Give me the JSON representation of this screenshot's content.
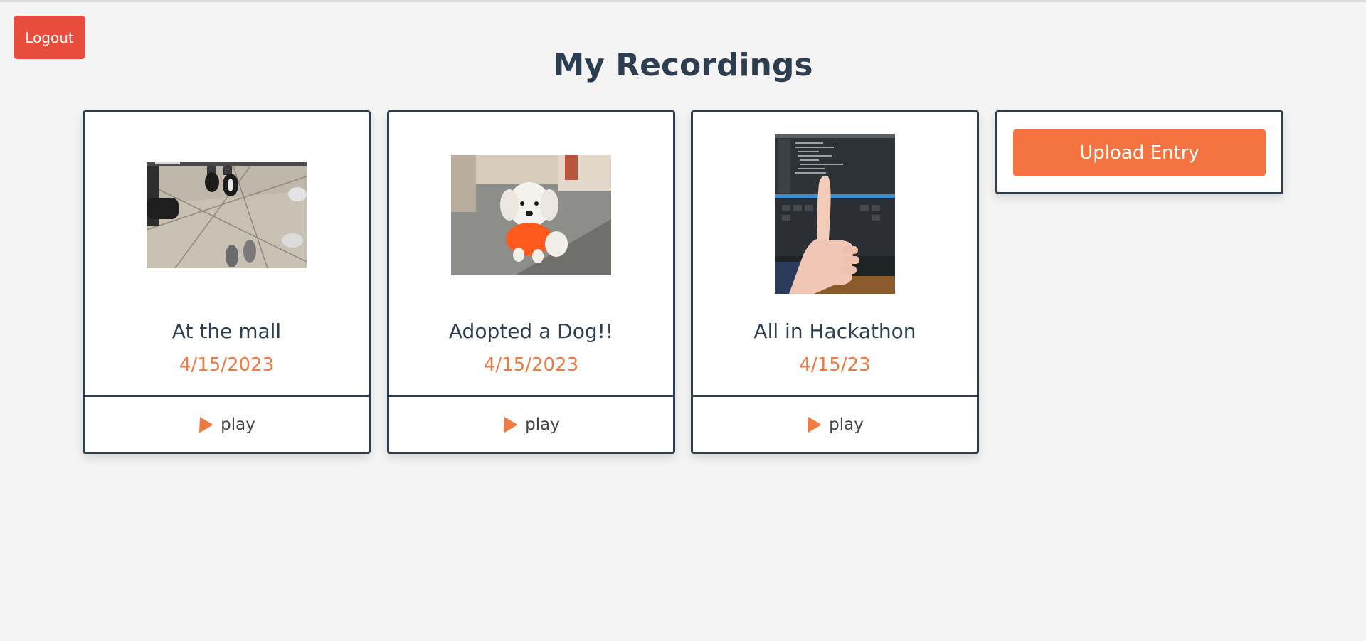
{
  "header": {
    "logout_label": "Logout",
    "title": "My Recordings"
  },
  "recordings": [
    {
      "title": "At the mall",
      "date": "4/15/2023",
      "play_label": "play",
      "thumbnail": "photo-shoes-on-tile-floor"
    },
    {
      "title": "Adopted a Dog!!",
      "date": "4/15/2023",
      "play_label": "play",
      "thumbnail": "photo-white-dog-orange-shirt"
    },
    {
      "title": "All in Hackathon",
      "date": "4/15/23",
      "play_label": "play",
      "thumbnail": "photo-thumbs-up-laptop"
    }
  ],
  "upload": {
    "label": "Upload Entry"
  },
  "colors": {
    "background": "#f4f4f4",
    "text": "#2c3e50",
    "accent": "#f47340",
    "logout": "#e74c3c",
    "date": "#f07a43"
  },
  "icons": {
    "play": "play-icon"
  }
}
